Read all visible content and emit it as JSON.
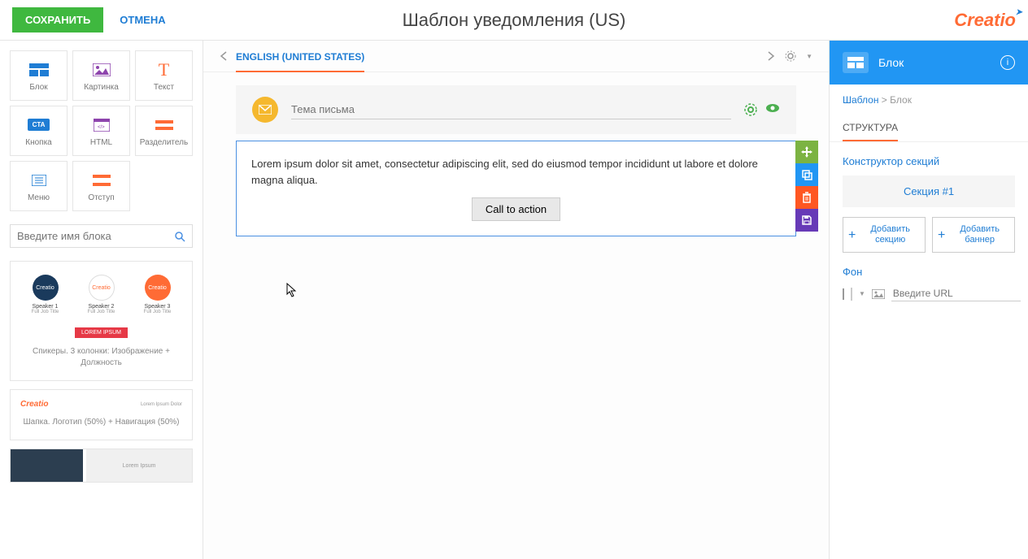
{
  "topbar": {
    "save": "СОХРАНИТЬ",
    "cancel": "ОТМЕНА",
    "title": "Шаблон уведомления (US)",
    "logo": "Creatio"
  },
  "tools": {
    "block": "Блок",
    "image": "Картинка",
    "text": "Текст",
    "button": "Кнопка",
    "html": "HTML",
    "divider": "Разделитель",
    "menu": "Меню",
    "indent": "Отступ"
  },
  "search": {
    "placeholder": "Введите имя блока"
  },
  "previews": {
    "speaker1": "Speaker 1",
    "speaker2": "Speaker 2",
    "speaker3": "Speaker 3",
    "jobtitle": "Full Job Title",
    "lorem_badge": "LOREM IPSUM",
    "speakers_caption": "Спикеры. 3 колонки: Изображение + Должность",
    "header_nav": "Lorem   Ipsum    Dolor",
    "header_caption": "Шапка. Логотип (50%) + Навигация (50%)",
    "footer_text": "Lorem Ipsum",
    "creatio_small": "Creatio"
  },
  "langbar": {
    "current": "ENGLISH (UNITED STATES)"
  },
  "canvas": {
    "subject_placeholder": "Тема письма",
    "lorem": "Lorem ipsum dolor sit amet, consectetur adipiscing elit, sed do eiusmod tempor incididunt ut labore et dolore magna aliqua.",
    "cta": "Call to action"
  },
  "rightpanel": {
    "header_title": "Блок",
    "breadcrumb_template": "Шаблон",
    "breadcrumb_sep": ">",
    "breadcrumb_block": "Блок",
    "tab_structure": "СТРУКТУРА",
    "section_constructor": "Конструктор секций",
    "section_1": "Секция #1",
    "add_section": "Добавить секцию",
    "add_banner": "Добавить баннер",
    "bg_title": "Фон",
    "url_placeholder": "Введите URL"
  }
}
